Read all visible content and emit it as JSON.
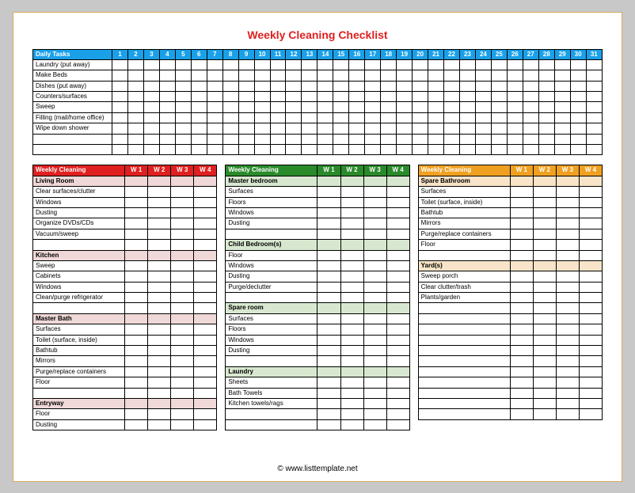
{
  "title": "Weekly Cleaning Checklist",
  "footer": "© www.listtemplate.net",
  "daily": {
    "header_label": "Daily Tasks",
    "days": [
      "1",
      "2",
      "3",
      "4",
      "5",
      "6",
      "7",
      "8",
      "9",
      "10",
      "11",
      "12",
      "13",
      "14",
      "15",
      "16",
      "17",
      "18",
      "19",
      "20",
      "21",
      "22",
      "23",
      "24",
      "25",
      "26",
      "27",
      "28",
      "29",
      "30",
      "31"
    ],
    "tasks": [
      "Laundry (put away)",
      "Make Beds",
      "Dishes (put away)",
      "Counters/surfaces",
      "Sweep",
      "Filling (mail/home office)",
      "Wipe down shower"
    ],
    "blank_rows": 2
  },
  "weekly_header_label": "Weekly Cleaning",
  "weeks": [
    "W 1",
    "W 2",
    "W 3",
    "W 4"
  ],
  "columns": [
    {
      "sections": [
        {
          "header": "Living Room",
          "tasks": [
            "Clear surfaces/clutter",
            "Windows",
            "Dusting",
            "Organize DVDs/CDs",
            "Vacuum/sweep"
          ]
        },
        {
          "header": "Kitchen",
          "tasks": [
            "Sweep",
            "Cabinets",
            "Windows",
            "Clean/purge refrigerator"
          ]
        },
        {
          "header": "Master Bath",
          "tasks": [
            "Surfaces",
            "Toilet (surface, inside)",
            "Bathtub",
            "Mirrors",
            "Purge/replace containers",
            "Floor"
          ]
        },
        {
          "header": "Entryway",
          "tasks": [
            "Floor",
            "Dusting"
          ]
        }
      ],
      "extra_rows": 0
    },
    {
      "sections": [
        {
          "header": "Master bedroom",
          "tasks": [
            "Surfaces",
            "Floors",
            "Windows",
            "Dusting"
          ]
        },
        {
          "header": "Child Bedroom(s)",
          "tasks": [
            "Floor",
            "Windows",
            "Dusting",
            "Purge/declutter"
          ]
        },
        {
          "header": "Spare room",
          "tasks": [
            "Surfaces",
            "Floors",
            "Windows",
            "Dusting"
          ]
        },
        {
          "header": "Laundry",
          "tasks": [
            "Sheets",
            "Bath Towels",
            "Kitchen towels/rags"
          ]
        }
      ],
      "extra_rows": 2
    },
    {
      "sections": [
        {
          "header": "Spare Bathroom",
          "tasks": [
            "Surfaces",
            "Toilet (surface, inside)",
            "Bathtub",
            "Mirrors",
            "Purge/replace containers",
            "Floor"
          ]
        },
        {
          "header": "Yard(s)",
          "tasks": [
            "Sweep porch",
            "Clear clutter/trash",
            "Plants/garden"
          ]
        }
      ],
      "extra_rows": 11
    }
  ]
}
